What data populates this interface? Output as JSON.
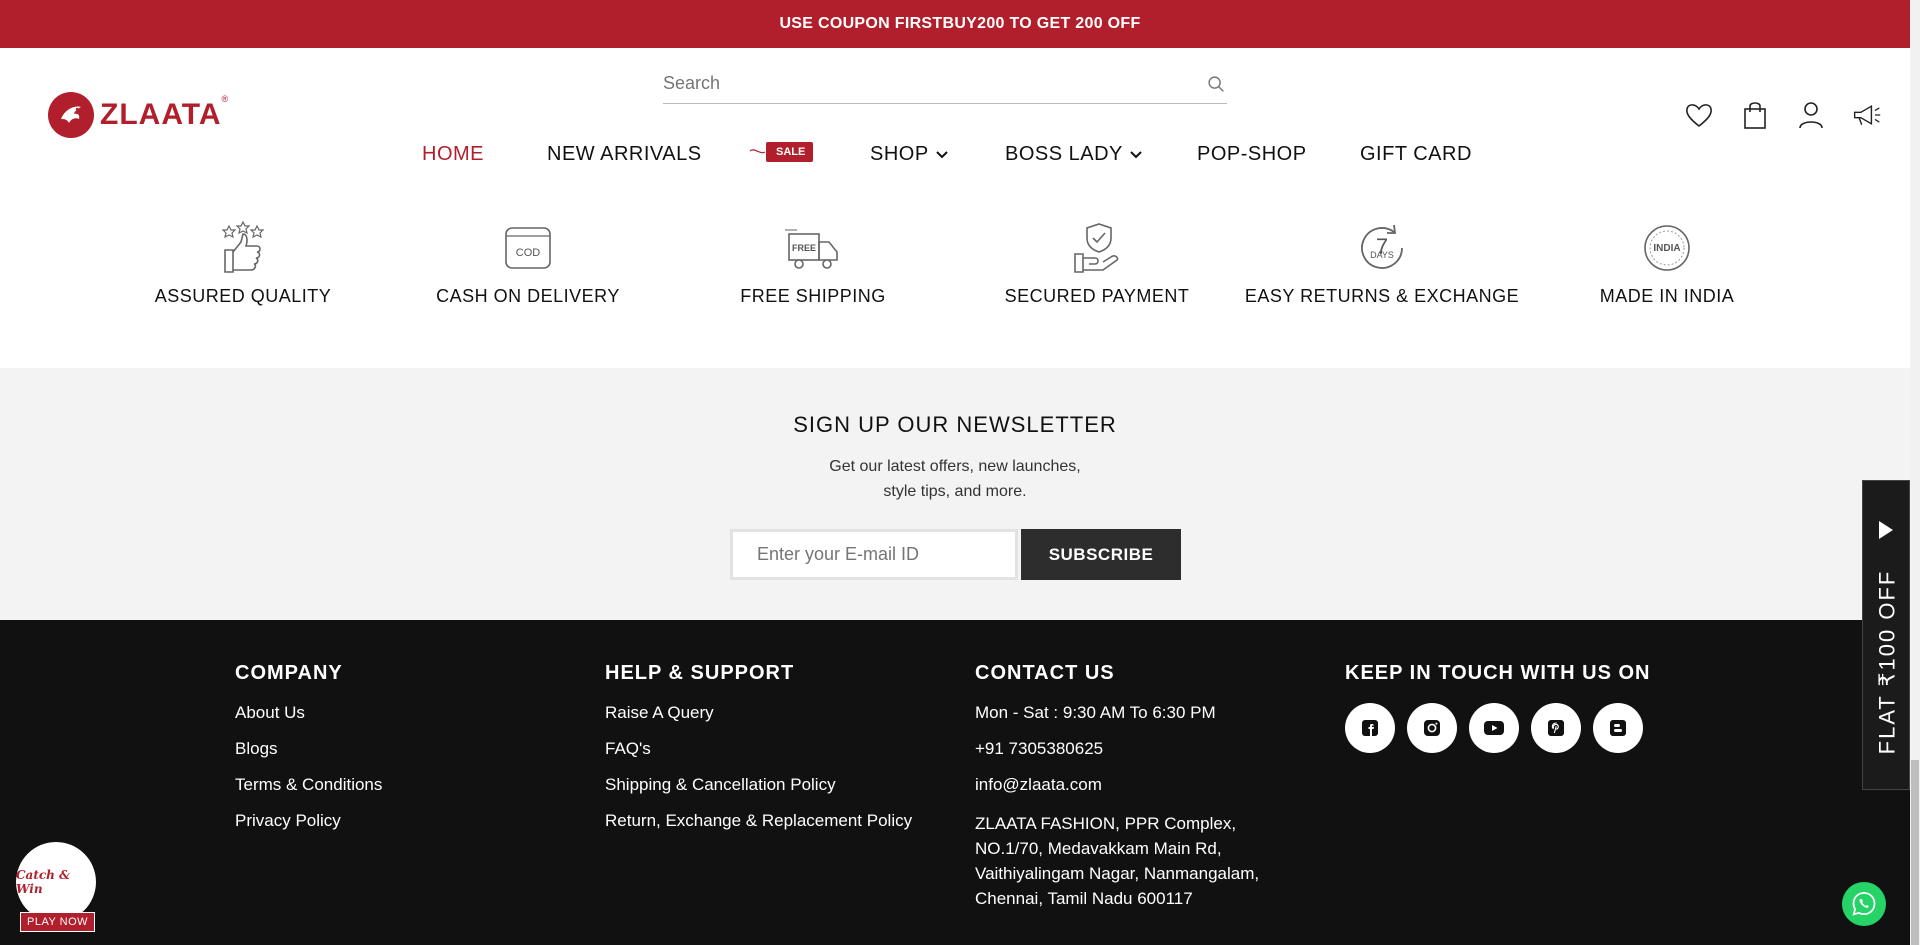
{
  "announcement": {
    "text": "USE COUPON FIRSTBUY200 TO GET 200 OFF"
  },
  "header": {
    "logo_text": "ZLAATA",
    "logo_reg": "®",
    "search_placeholder": "Search",
    "nav": [
      {
        "label": "HOME",
        "active": true
      },
      {
        "label": "NEW ARRIVALS"
      },
      {
        "label": "SALE"
      },
      {
        "label": "SHOP"
      },
      {
        "label": "BOSS LADY"
      },
      {
        "label": "POP-SHOP"
      },
      {
        "label": "GIFT CARD"
      }
    ],
    "icons": [
      "wishlist-heart-icon",
      "shopping-bag-icon",
      "account-icon",
      "announcement-megaphone-icon"
    ]
  },
  "features": [
    {
      "label": "ASSURED QUALITY",
      "icon": "thumbs-up-stars-icon"
    },
    {
      "label": "CASH ON DELIVERY",
      "icon_text": "COD",
      "icon": "cod-icon"
    },
    {
      "label": "FREE SHIPPING",
      "icon_text": "FREE",
      "icon": "delivery-truck-icon"
    },
    {
      "label": "SECURED PAYMENT",
      "icon": "secure-hand-shield-icon"
    },
    {
      "label": "EASY RETURNS & EXCHANGE",
      "icon_text": "7",
      "icon_subtext": "DAYS",
      "icon": "seven-days-return-icon"
    },
    {
      "label": "MADE IN INDIA",
      "icon_text": "INDIA",
      "icon": "made-in-india-seal-icon"
    }
  ],
  "newsletter": {
    "title": "SIGN UP OUR NEWSLETTER",
    "subtitle_line1": "Get our latest offers, new launches,",
    "subtitle_line2": "style tips, and more.",
    "email_placeholder": "Enter your E-mail ID",
    "button_label": "SUBSCRIBE"
  },
  "footer": {
    "company": {
      "heading": "COMPANY",
      "links": [
        "About Us",
        "Blogs",
        "Terms & Conditions",
        "Privacy Policy"
      ]
    },
    "help": {
      "heading": "HELP & SUPPORT",
      "links": [
        "Raise A Query",
        "FAQ's",
        "Shipping & Cancellation Policy",
        "Return, Exchange & Replacement Policy"
      ]
    },
    "contact": {
      "heading": "CONTACT US",
      "hours": "Mon - Sat : 9:30 AM To 6:30 PM",
      "phone": "+91 7305380625",
      "email": "info@zlaata.com",
      "address": "ZLAATA FASHION, PPR Complex, NO.1/70, Medavakkam Main Rd, Vaithiyalingam Nagar, Nanmangalam, Chennai, Tamil Nadu 600117"
    },
    "social": {
      "heading": "KEEP IN TOUCH WITH US ON",
      "icons": [
        "facebook-icon",
        "instagram-icon",
        "youtube-icon",
        "pinterest-icon",
        "blogger-icon"
      ]
    }
  },
  "widgets": {
    "flat_offer": "FLAT ₹100 OFF",
    "catch_win": "Catch & Win",
    "play_now": "PLAY NOW"
  },
  "colors": {
    "brand": "#b01f2b",
    "footer_bg": "#111111",
    "newsletter_bg": "#f3f3f3",
    "whatsapp": "#25d366"
  }
}
